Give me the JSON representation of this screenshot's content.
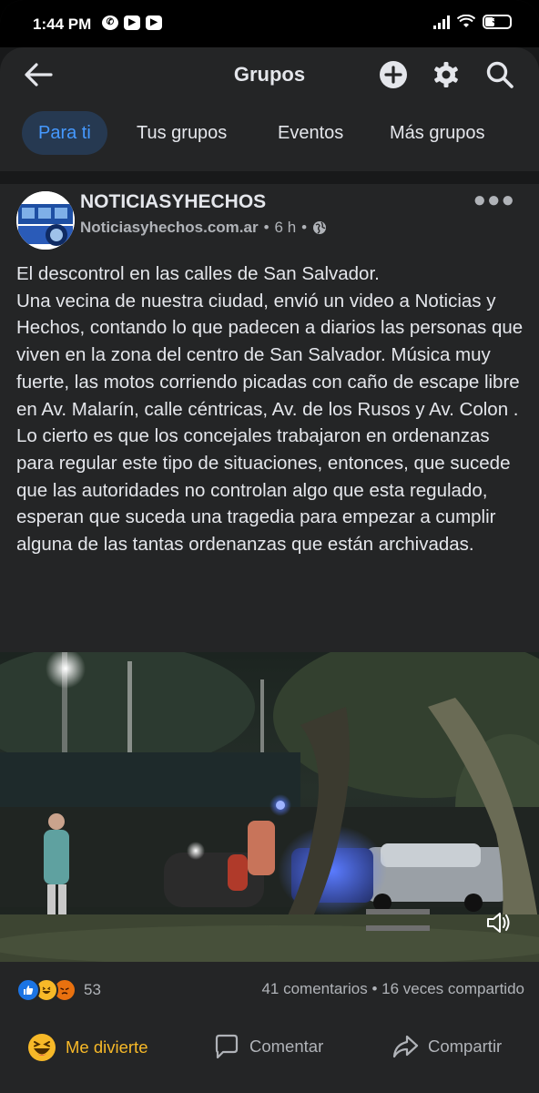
{
  "status_bar": {
    "time": "1:44 PM",
    "battery": "36"
  },
  "header": {
    "title": "Grupos"
  },
  "tabs": [
    {
      "label": "Para ti",
      "active": true
    },
    {
      "label": "Tus grupos"
    },
    {
      "label": "Eventos"
    },
    {
      "label": "Más grupos"
    }
  ],
  "post": {
    "author": "NOTICIASYHECHOS",
    "source": "Noticiasyhechos.com.ar",
    "time": "6 h",
    "paragraphs": [
      "El descontrol en las calles de San Salvador.",
      "Una vecina de nuestra ciudad, envió un video a Noticias y Hechos, contando  lo que padecen a diarios las personas que viven en la zona del centro de San Salvador. Música muy fuerte, las motos corriendo picadas con caño de escape libre en Av. Malarín, calle céntricas, Av. de los Rusos y Av. Colon .",
      "Lo cierto es que los concejales trabajaron en ordenanzas para regular este tipo de situaciones, entonces, que sucede que las autoridades no controlan algo que esta regulado, esperan que suceda una tragedia para empezar a cumplir alguna de las tantas ordenanzas que están archivadas."
    ],
    "reaction_count": "53",
    "comments": "41 comentarios",
    "shares": "16 veces compartido",
    "separator": "•"
  },
  "actions": {
    "reacted": "Me divierte",
    "comment": "Comentar",
    "share": "Compartir"
  },
  "colors": {
    "background": "#18191a",
    "surface": "#242526",
    "accent": "#4599ff",
    "haha": "#f7b928"
  }
}
